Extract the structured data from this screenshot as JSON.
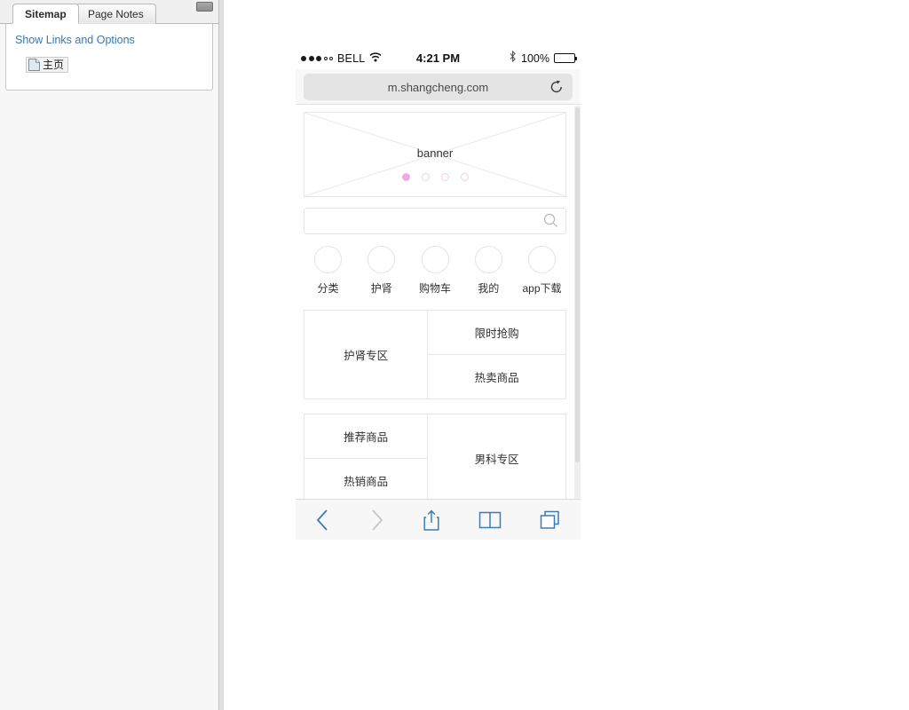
{
  "sidebar": {
    "tabs": [
      {
        "label": "Sitemap",
        "active": true
      },
      {
        "label": "Page Notes",
        "active": false
      }
    ],
    "show_links_label": "Show Links and Options",
    "tree": [
      {
        "label": "主页",
        "icon": "page-icon",
        "selected": true
      }
    ],
    "collapse_button_name": "collapse-panel-button"
  },
  "phone": {
    "status_bar": {
      "signal_filled": 3,
      "signal_empty": 2,
      "carrier": "BELL",
      "wifi_icon": "wifi-icon",
      "time": "4:21 PM",
      "bluetooth_icon": "bluetooth-icon",
      "battery_percent": "100%",
      "battery_icon": "battery-full-icon"
    },
    "browser": {
      "url": "m.shangcheng.com",
      "reload_icon": "reload-icon"
    },
    "page": {
      "banner": {
        "label": "banner",
        "dots": 4,
        "active_dot": 0,
        "active_dot_color": "#eeaae6",
        "inactive_dot_color": "#f0cdeb"
      },
      "search": {
        "value": "",
        "placeholder": "",
        "icon": "search-icon"
      },
      "quicknav": [
        {
          "label": "分类",
          "icon": "category-icon"
        },
        {
          "label": "护肾",
          "icon": "kidney-care-icon"
        },
        {
          "label": "购物车",
          "icon": "cart-icon"
        },
        {
          "label": "我的",
          "icon": "profile-icon"
        },
        {
          "label": "app下载",
          "icon": "download-icon"
        }
      ],
      "blocks": [
        {
          "left": [
            "护肾专区"
          ],
          "right": [
            "限时抢购",
            "热卖商品"
          ]
        },
        {
          "left": [
            "推荐商品",
            "热销商品"
          ],
          "right": [
            "男科专区"
          ]
        },
        {
          "left": [
            ""
          ],
          "right": [
            ""
          ]
        }
      ]
    },
    "toolbar": [
      {
        "name": "back-button",
        "icon": "chevron-left-icon",
        "enabled": true
      },
      {
        "name": "forward-button",
        "icon": "chevron-right-icon",
        "enabled": false
      },
      {
        "name": "share-button",
        "icon": "share-icon",
        "enabled": true
      },
      {
        "name": "bookmarks-button",
        "icon": "book-icon",
        "enabled": true
      },
      {
        "name": "tabs-button",
        "icon": "tabs-icon",
        "enabled": true
      }
    ],
    "colors": {
      "safari_blue": "#3c7cb5",
      "safari_blue_disabled": "#c6c6c6"
    }
  }
}
